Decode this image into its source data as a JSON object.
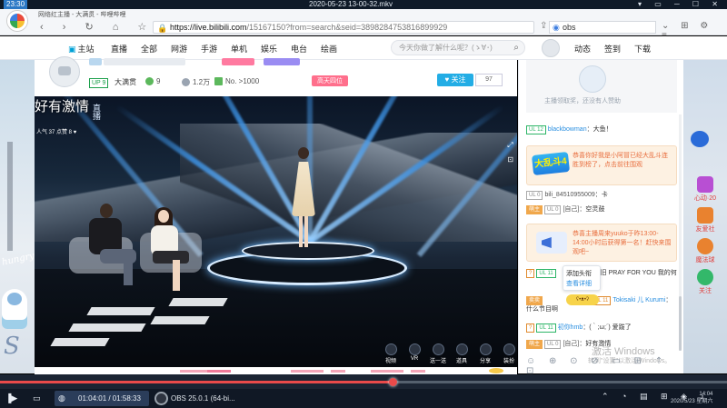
{
  "player": {
    "time": "23:30",
    "title": "2020-05-23 13-00-32.mkv",
    "controls": "▾ ▭ ─ ☐ ✕"
  },
  "browser": {
    "tab_title": "网络红主播 - 大满贯 - 哔哩哔哩",
    "nav_icons": "‹ › ↻ ⌂ ☆",
    "url_host": "https://live.bilibili.com",
    "url_rest": "/15167150?from=search&seid=3898284753816899929",
    "search_value": "obs",
    "tools": "⌄ ⊞ ⚙ ≡"
  },
  "sitenav": {
    "items": [
      {
        "label": "主站",
        "icon": "tv-icon"
      },
      {
        "label": "直播"
      },
      {
        "label": "全部"
      },
      {
        "label": "网游"
      },
      {
        "label": "手游"
      },
      {
        "label": "单机"
      },
      {
        "label": "娱乐"
      },
      {
        "label": "电台"
      },
      {
        "label": "绘画"
      }
    ],
    "search_placeholder": "今天你做了解什么呢？(ゝ∀･)",
    "right_items": [
      "动态",
      "签到",
      "下载"
    ]
  },
  "room": {
    "up_badge": "UP 9",
    "category": "大满贯",
    "stat_green": "9",
    "stat_views": "1.2万",
    "rank": "No. >1000",
    "online_list": "高天四位",
    "follow": "♥ 关注",
    "fans": "97"
  },
  "video": {
    "overlay_title": "好有激情",
    "overlay_tag": "直播",
    "overlay_fans": "人气 37   点赞 8 ♥",
    "side_controls": [
      "⤢",
      "⊡"
    ],
    "bottom_controls": [
      "视频",
      "VR",
      "送一送",
      "道具",
      "分享",
      "装扮"
    ],
    "left_bg_text": "hungry",
    "left_bg_letter": "S"
  },
  "chat": {
    "rank_text": "主播领取奖，还没有人赞助",
    "messages": [
      {
        "level": "UL 12",
        "user": "blackbowman",
        "text": "：大鱼！"
      },
      {
        "level": "UL 0",
        "user": "bili_84510955009",
        "text": "：卡"
      },
      {
        "medal": "萌主",
        "level": "UL 0",
        "user": "[自己]",
        "text": "：空灵鼓"
      },
      {
        "medal": "?",
        "level": "UL 11",
        "user": "",
        "text": "相旧 PRAY FOR YOU 我的何"
      },
      {
        "medal": "卖卖",
        "level": "UL 11",
        "user": "Tokisaki 儿 Kurumi",
        "text": "：什么节目啊"
      },
      {
        "medal": "?",
        "level": "UL 11",
        "user": "初你hmb",
        "text": "：(｀;ω;´) 爱跋了"
      },
      {
        "medal": "萌主",
        "level": "UL 0",
        "user": "[自己]",
        "text": "：好有激情"
      }
    ],
    "sys1": "恭喜你好我是小阿冒已经大乱斗连胜到榜了，点击前往围观",
    "sys1_badge": "大乱斗4",
    "sys2": "恭喜主播周来yuuko于昨13:00-14:00小时后获得第一名！赶快来围观吧~",
    "popup_line1": "添加头衔",
    "popup_line2": "查看详细",
    "emoji": "ʕ•ᴥ•ʔ",
    "watermark": "激活 Windows",
    "watermark2": "转到\"设置\"以激活 Windows。",
    "toolbar": "☺ ⊕ ⊙ ⊘ ▭ ⊞ ⇡ ⊡"
  },
  "rightbar": {
    "items": [
      {
        "label": "心动·20",
        "color": "#b84fd3"
      },
      {
        "label": "友爱社",
        "color": "#e9822f"
      },
      {
        "label": "魔法球",
        "color": "#e9822f"
      },
      {
        "label": "关注",
        "color": "#33b86a"
      }
    ]
  },
  "progress": {
    "fraction": 0.54
  },
  "taskbar": {
    "media_time": "01:04:01 / 01:58:33",
    "obs_label": "OBS 25.0.1 (64-bi...",
    "tray": "⌃ ◔ ▤ ⊞ ◈ ♪",
    "clock_time": "14:04",
    "clock_date": "2020/5/23 星期六"
  }
}
